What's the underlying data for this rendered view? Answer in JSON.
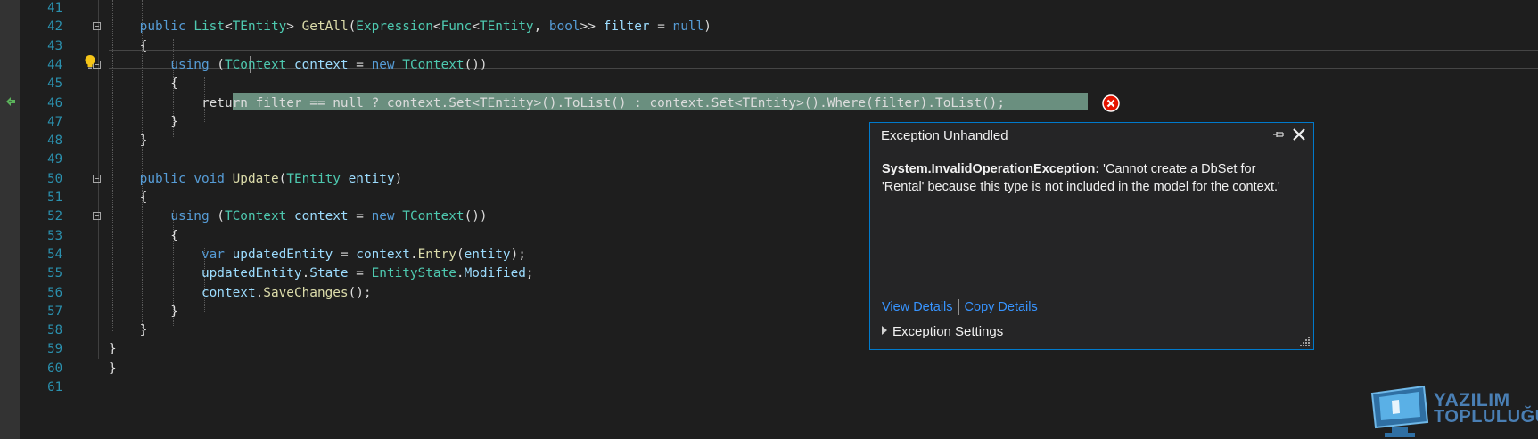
{
  "editor": {
    "lines": [
      {
        "num": "41",
        "segments": []
      },
      {
        "num": "42",
        "segments": [
          [
            "t",
            "    "
          ],
          [
            "kw",
            "public"
          ],
          [
            "t",
            " "
          ],
          [
            "ty",
            "List"
          ],
          [
            "t",
            "<"
          ],
          [
            "ty",
            "TEntity"
          ],
          [
            "t",
            "> "
          ],
          [
            "fn",
            "GetAll"
          ],
          [
            "t",
            "("
          ],
          [
            "ty",
            "Expression"
          ],
          [
            "t",
            "<"
          ],
          [
            "ty",
            "Func"
          ],
          [
            "t",
            "<"
          ],
          [
            "ty",
            "TEntity"
          ],
          [
            "t",
            ", "
          ],
          [
            "kw",
            "bool"
          ],
          [
            "t",
            ">> "
          ],
          [
            "va",
            "filter"
          ],
          [
            "t",
            " = "
          ],
          [
            "kw",
            "null"
          ],
          [
            "t",
            ")"
          ]
        ]
      },
      {
        "num": "43",
        "segments": [
          [
            "t",
            "    {"
          ]
        ]
      },
      {
        "num": "44",
        "segments": [
          [
            "t",
            "        "
          ],
          [
            "kw",
            "using"
          ],
          [
            "t",
            " ("
          ],
          [
            "ty",
            "TContext"
          ],
          [
            "t",
            " "
          ],
          [
            "va",
            "context"
          ],
          [
            "t",
            " = "
          ],
          [
            "kw",
            "new"
          ],
          [
            "t",
            " "
          ],
          [
            "ty",
            "TContext"
          ],
          [
            "t",
            "())"
          ]
        ]
      },
      {
        "num": "45",
        "segments": [
          [
            "t",
            "        {"
          ]
        ]
      },
      {
        "num": "46",
        "segments": [
          [
            "t",
            "            "
          ],
          [
            "t",
            "return filter == null ? context.Set<TEntity>().ToList() : context.Set<TEntity>().Where(filter).ToList();"
          ]
        ]
      },
      {
        "num": "47",
        "segments": [
          [
            "t",
            "        }"
          ]
        ]
      },
      {
        "num": "48",
        "segments": [
          [
            "t",
            "    }"
          ]
        ]
      },
      {
        "num": "49",
        "segments": []
      },
      {
        "num": "50",
        "segments": [
          [
            "t",
            "    "
          ],
          [
            "kw",
            "public"
          ],
          [
            "t",
            " "
          ],
          [
            "kw",
            "void"
          ],
          [
            "t",
            " "
          ],
          [
            "fn",
            "Update"
          ],
          [
            "t",
            "("
          ],
          [
            "ty",
            "TEntity"
          ],
          [
            "t",
            " "
          ],
          [
            "va",
            "entity"
          ],
          [
            "t",
            ")"
          ]
        ]
      },
      {
        "num": "51",
        "segments": [
          [
            "t",
            "    {"
          ]
        ]
      },
      {
        "num": "52",
        "segments": [
          [
            "t",
            "        "
          ],
          [
            "kw",
            "using"
          ],
          [
            "t",
            " ("
          ],
          [
            "ty",
            "TContext"
          ],
          [
            "t",
            " "
          ],
          [
            "va",
            "context"
          ],
          [
            "t",
            " = "
          ],
          [
            "kw",
            "new"
          ],
          [
            "t",
            " "
          ],
          [
            "ty",
            "TContext"
          ],
          [
            "t",
            "())"
          ]
        ]
      },
      {
        "num": "53",
        "segments": [
          [
            "t",
            "        {"
          ]
        ]
      },
      {
        "num": "54",
        "segments": [
          [
            "t",
            "            "
          ],
          [
            "kw",
            "var"
          ],
          [
            "t",
            " "
          ],
          [
            "va",
            "updatedEntity"
          ],
          [
            "t",
            " = "
          ],
          [
            "va",
            "context"
          ],
          [
            "t",
            "."
          ],
          [
            "fn",
            "Entry"
          ],
          [
            "t",
            "("
          ],
          [
            "va",
            "entity"
          ],
          [
            "t",
            ");"
          ]
        ]
      },
      {
        "num": "55",
        "segments": [
          [
            "t",
            "            "
          ],
          [
            "va",
            "updatedEntity"
          ],
          [
            "t",
            "."
          ],
          [
            "va",
            "State"
          ],
          [
            "t",
            " = "
          ],
          [
            "ty",
            "EntityState"
          ],
          [
            "t",
            "."
          ],
          [
            "va",
            "Modified"
          ],
          [
            "t",
            ";"
          ]
        ]
      },
      {
        "num": "56",
        "segments": [
          [
            "t",
            "            "
          ],
          [
            "va",
            "context"
          ],
          [
            "t",
            "."
          ],
          [
            "fn",
            "SaveChanges"
          ],
          [
            "t",
            "();"
          ]
        ]
      },
      {
        "num": "57",
        "segments": [
          [
            "t",
            "        }"
          ]
        ]
      },
      {
        "num": "58",
        "segments": [
          [
            "t",
            "    }"
          ]
        ]
      },
      {
        "num": "59",
        "segments": [
          [
            "t",
            "}"
          ]
        ]
      },
      {
        "num": "60",
        "segments": [
          [
            "t",
            "}"
          ]
        ]
      },
      {
        "num": "61",
        "segments": []
      }
    ],
    "fold_lines": [
      "42",
      "44",
      "50",
      "52"
    ]
  },
  "exception_popup": {
    "title": "Exception Unhandled",
    "exception_type": "System.InvalidOperationException:",
    "message": " 'Cannot create a DbSet for 'Rental' because this type is not included in the model for the context.'",
    "view_details_label": "View Details",
    "copy_details_label": "Copy Details",
    "settings_label": "Exception Settings"
  },
  "watermark": {
    "line1": "YAZILIM",
    "line2": "TOPLULUĞU"
  },
  "colors": {
    "accent": "#007acc",
    "error": "#e51400",
    "link": "#3794ff",
    "highlight": "#6a8f7f"
  },
  "icons": [
    "back-arrow-icon",
    "lightbulb-icon",
    "error-icon",
    "pin-icon",
    "close-icon",
    "resize-grip-icon",
    "expand-triangle-icon",
    "logo-icon"
  ]
}
